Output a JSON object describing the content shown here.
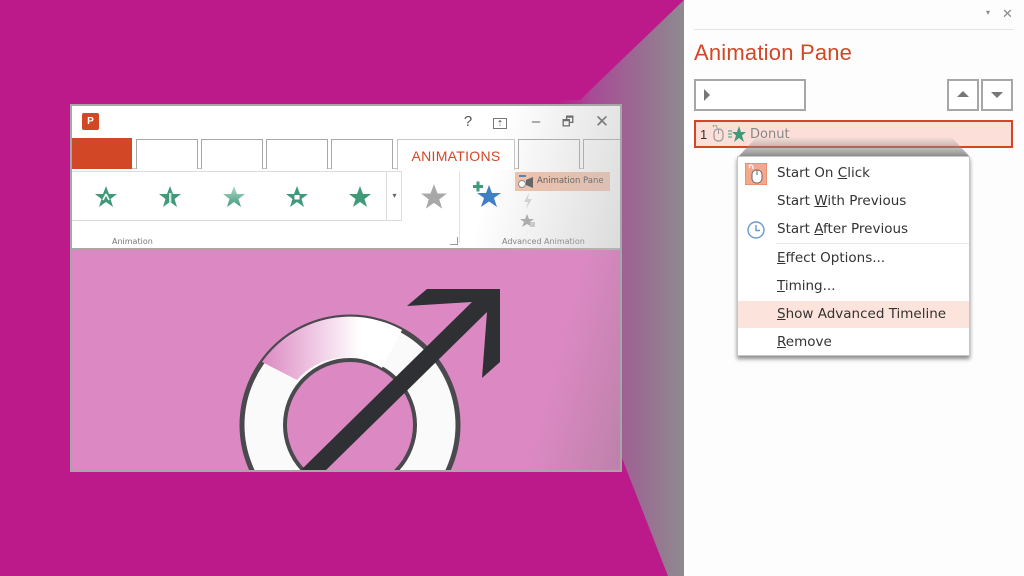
{
  "colors": {
    "background": "#bc1a8a",
    "accent": "#d24726",
    "slide": "#dc89c3",
    "highlight": "#fce4dc",
    "star_green": "#3f9a7a",
    "star_blue": "#3e7ec4"
  },
  "ppt_window": {
    "logo_icon": "powerpoint-logo-icon",
    "logo_text": "P",
    "controls": {
      "help": "?",
      "ribbon_options": "⇡",
      "minimize": "–",
      "restore": "🗗",
      "close": "✕"
    },
    "tabs": [
      "",
      "",
      "",
      "",
      "",
      "ANIMATIONS",
      "",
      ""
    ],
    "active_tab": "ANIMATIONS",
    "ribbon": {
      "animation_group_label": "Animation",
      "animation_gallery": [
        "Appear",
        "Fade",
        "Fly In",
        "Float In",
        "Split"
      ],
      "effect_options_icon": "gray-star-icon",
      "advanced_group_label": "Advanced Animation",
      "add_animation_icon": "add-animation-star-icon",
      "animation_pane_button": "Animation Pane",
      "trigger_icon": "lightning-icon",
      "painter_icon": "animation-painter-icon"
    },
    "slide": {
      "graphic": "donut-with-arrow"
    }
  },
  "animation_pane": {
    "title": "Animation Pane",
    "play_button_icon": "play-icon",
    "move_up_icon": "triangle-up-icon",
    "move_down_icon": "triangle-down-icon",
    "pane_menu_icon": "▾",
    "pane_close_icon": "✕",
    "items": [
      {
        "number": "1",
        "trigger_icon": "mouse-icon",
        "effect_icon": "green-star-icon",
        "name": "Donut"
      }
    ]
  },
  "context_menu": {
    "items": [
      {
        "pre": "Start On ",
        "key": "C",
        "post": "lick",
        "icon": "mouse-icon",
        "checked": true
      },
      {
        "pre": "Start ",
        "key": "W",
        "post": "ith Previous",
        "icon": "",
        "checked": false
      },
      {
        "pre": "Start ",
        "key": "A",
        "post": "fter Previous",
        "icon": "clock-icon",
        "checked": false
      },
      {
        "pre": "",
        "key": "E",
        "post": "ffect Options...",
        "icon": "",
        "checked": false
      },
      {
        "pre": "",
        "key": "T",
        "post": "iming...",
        "icon": "",
        "checked": false
      },
      {
        "pre": "",
        "key": "S",
        "post": "how Advanced Timeline",
        "icon": "",
        "checked": false,
        "highlighted": true
      },
      {
        "pre": "",
        "key": "R",
        "post": "emove",
        "icon": "",
        "checked": false
      }
    ]
  }
}
